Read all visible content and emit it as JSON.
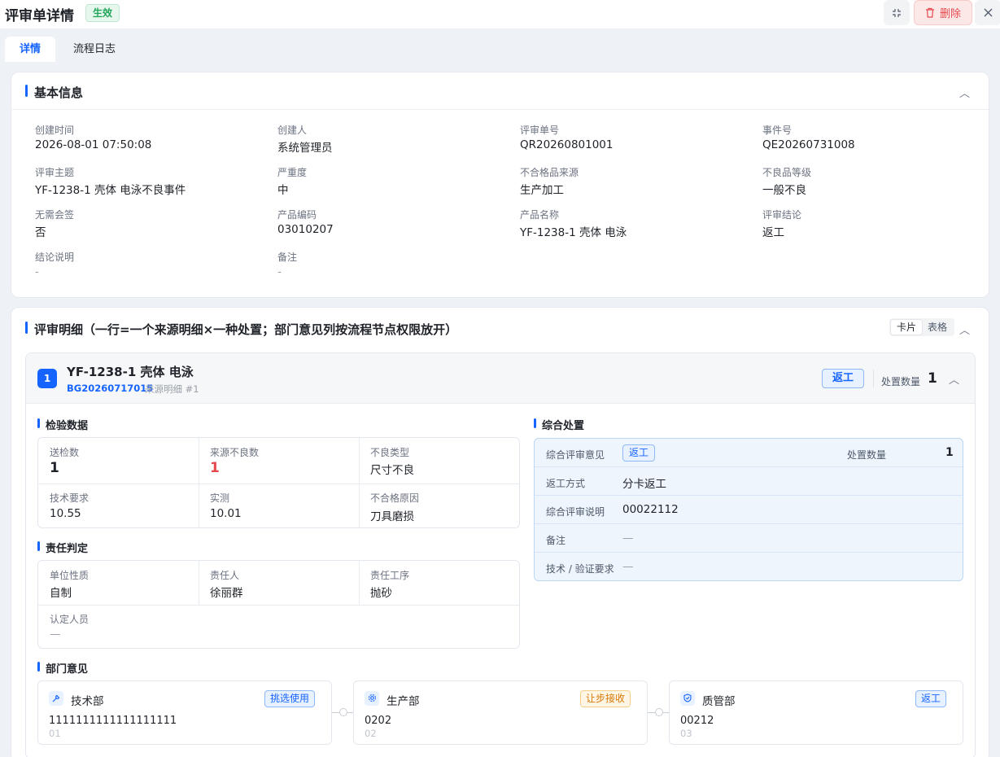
{
  "header": {
    "title": "评审单详情",
    "status": "生效",
    "delete_label": "删除"
  },
  "tabs": [
    {
      "label": "详情",
      "active": true
    },
    {
      "label": "流程日志",
      "active": false
    }
  ],
  "basic_info": {
    "title": "基本信息",
    "fields": [
      {
        "label": "创建时间",
        "value": "2026-08-01 07:50:08"
      },
      {
        "label": "创建人",
        "value": "系统管理员"
      },
      {
        "label": "评审单号",
        "value": "QR20260801001"
      },
      {
        "label": "事件号",
        "value": "QE20260731008"
      },
      {
        "label": "评审主题",
        "value": "YF-1238-1 壳体 电泳不良事件"
      },
      {
        "label": "严重度",
        "value": "中"
      },
      {
        "label": "不合格品来源",
        "value": "生产加工"
      },
      {
        "label": "不良品等级",
        "value": "一般不良"
      },
      {
        "label": "无需会签",
        "value": "否"
      },
      {
        "label": "产品编码",
        "value": "03010207"
      },
      {
        "label": "产品名称",
        "value": "YF-1238-1 壳体 电泳"
      },
      {
        "label": "评审结论",
        "value": "返工"
      },
      {
        "label": "结论说明",
        "value": "-"
      },
      {
        "label": "备注",
        "value": "-"
      }
    ]
  },
  "detail": {
    "title": "评审明细（一行=一个来源明细×一种处置；部门意见列按流程节点权限放开）",
    "view_options": [
      "卡片",
      "表格"
    ],
    "view_selected": "卡片",
    "item": {
      "index": "1",
      "name": "YF-1238-1 壳体 电泳",
      "code": "BG20260717015",
      "source": "来源明细 #1",
      "disposition": "返工",
      "qty_label": "处置数量",
      "qty": "1",
      "inspection": {
        "title": "检验数据",
        "cells": [
          {
            "label": "送检数",
            "value": "1"
          },
          {
            "label": "来源不良数",
            "value": "1"
          },
          {
            "label": "不良类型",
            "value": "尺寸不良"
          },
          {
            "label": "技术要求",
            "value": "10.55"
          },
          {
            "label": "实测",
            "value": "10.01"
          },
          {
            "label": "不合格原因",
            "value": "刀具磨损"
          }
        ]
      },
      "responsibility": {
        "title": "责任判定",
        "cells": [
          {
            "label": "单位性质",
            "value": "自制"
          },
          {
            "label": "责任人",
            "value": "徐丽群"
          },
          {
            "label": "责任工序",
            "value": "抛砂"
          },
          {
            "label": "认定人员",
            "value": "—"
          }
        ]
      },
      "summary": {
        "title": "综合处置",
        "opinion_label": "综合评审意见",
        "opinion_value": "返工",
        "qty_label": "处置数量",
        "qty_value": "1",
        "rows": [
          {
            "label": "返工方式",
            "value": "分卡返工"
          },
          {
            "label": "综合评审说明",
            "value": "00022112"
          },
          {
            "label": "备注",
            "value": "—"
          },
          {
            "label": "技术 / 验证要求",
            "value": "—"
          }
        ]
      },
      "departments": {
        "title": "部门意见",
        "list": [
          {
            "name": "技术部",
            "icon": "wrench-icon",
            "tag": "挑选使用",
            "tag_color": "blue",
            "opinion": "1111111111111111111",
            "no": "01"
          },
          {
            "name": "生产部",
            "icon": "gear-icon",
            "tag": "让步接收",
            "tag_color": "orange",
            "opinion": "0202",
            "no": "02"
          },
          {
            "name": "质管部",
            "icon": "shield-icon",
            "tag": "返工",
            "tag_color": "blue",
            "opinion": "00212",
            "no": "03"
          }
        ]
      }
    }
  }
}
